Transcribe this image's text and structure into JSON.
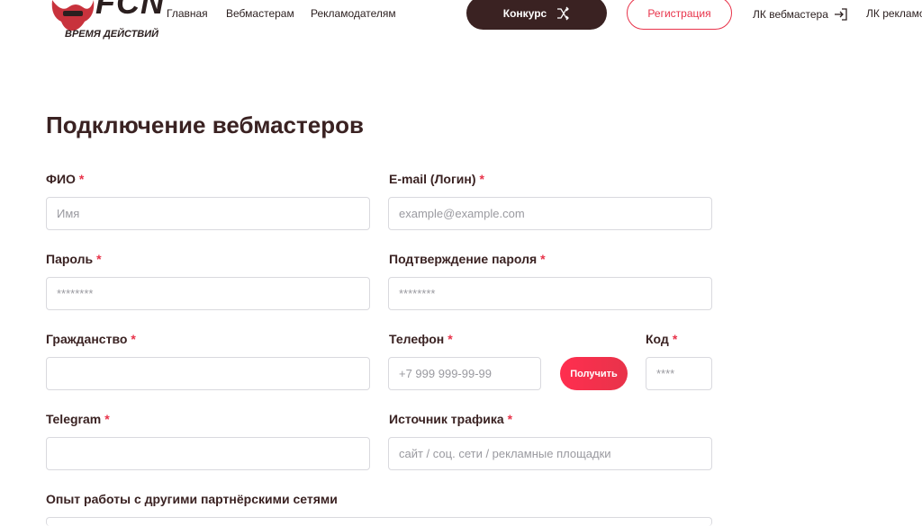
{
  "header": {
    "logo_text": "FCN",
    "logo_sub": "ВРЕМЯ ДЕЙСТВИЙ",
    "nav": [
      "Главная",
      "Вебмастерам",
      "Рекламодателям"
    ],
    "contest_label": "Конкурс",
    "register_label": "Регистрация",
    "lk_webmaster": "ЛК вебмастера",
    "lk_advertiser": "ЛК рекламо"
  },
  "page_title": "Подключение вебмастеров",
  "form": {
    "fio_label": "ФИО",
    "fio_placeholder": "Имя",
    "email_label": "E-mail (Логин)",
    "email_placeholder": "example@example.com",
    "password_label": "Пароль",
    "password_placeholder": "********",
    "password_confirm_label": "Подтверждение пароля",
    "password_confirm_placeholder": "********",
    "citizenship_label": "Гражданство",
    "phone_label": "Телефон",
    "phone_placeholder": "+7 999 999-99-99",
    "get_code_label": "Получить",
    "code_label": "Код",
    "code_placeholder": "****",
    "telegram_label": "Telegram",
    "traffic_label": "Источник трафика",
    "traffic_placeholder": "сайт / соц. сети / рекламные площадки",
    "experience_label": "Опыт работы с другими партнёрскими сетями",
    "required_mark": "*"
  },
  "colors": {
    "accent": "#e8334a",
    "dark": "#3a2222"
  }
}
